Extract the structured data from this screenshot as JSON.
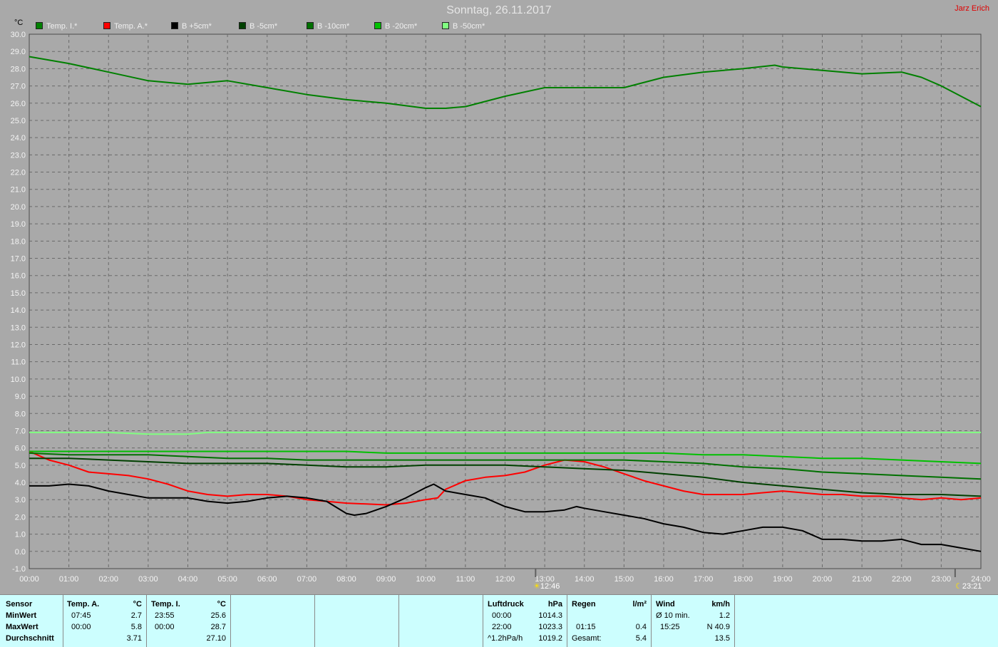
{
  "title": "Sonntag, 26.11.2017",
  "author": "Jarz Erich",
  "y_unit": "°C",
  "markers": [
    {
      "time_label": "12:46",
      "icon": "sunrise-icon",
      "hour": 12.77
    },
    {
      "time_label": "23:21",
      "icon": "moon-icon",
      "hour": 23.35
    }
  ],
  "chart_data": {
    "type": "line",
    "title": "Sonntag, 26.11.2017",
    "ylabel": "°C",
    "ylim": [
      -1.0,
      30.0
    ],
    "xlim": [
      0,
      24
    ],
    "x_tick_labels": [
      "00:00",
      "01:00",
      "02:00",
      "03:00",
      "04:00",
      "05:00",
      "06:00",
      "07:00",
      "08:00",
      "09:00",
      "10:00",
      "11:00",
      "12:00",
      "13:00",
      "14:00",
      "15:00",
      "16:00",
      "17:00",
      "18:00",
      "19:00",
      "20:00",
      "21:00",
      "22:00",
      "23:00",
      "24:00"
    ],
    "y_tick_labels": [
      "-1.0",
      "0.0",
      "1.0",
      "2.0",
      "3.0",
      "4.0",
      "5.0",
      "6.0",
      "7.0",
      "8.0",
      "9.0",
      "10.0",
      "11.0",
      "12.0",
      "13.0",
      "14.0",
      "15.0",
      "16.0",
      "17.0",
      "18.0",
      "19.0",
      "20.0",
      "21.0",
      "22.0",
      "23.0",
      "24.0",
      "25.0",
      "26.0",
      "27.0",
      "28.0",
      "29.0",
      "30.0"
    ],
    "grid": true,
    "legend_position": "top-left",
    "series": [
      {
        "name": "Temp. I.*",
        "color": "#008000",
        "x": [
          0,
          1,
          2,
          3,
          4,
          5,
          6,
          7,
          8,
          9,
          10,
          10.5,
          11,
          12,
          13,
          14,
          15,
          16,
          17,
          18,
          18.8,
          19,
          20,
          21,
          22,
          22.5,
          23,
          23.5,
          24
        ],
        "values": [
          28.7,
          28.3,
          27.8,
          27.3,
          27.1,
          27.3,
          26.9,
          26.5,
          26.2,
          26.0,
          25.7,
          25.7,
          25.8,
          26.4,
          26.9,
          26.9,
          26.9,
          27.5,
          27.8,
          28.0,
          28.2,
          28.1,
          27.9,
          27.7,
          27.8,
          27.5,
          27.0,
          26.4,
          25.8
        ]
      },
      {
        "name": "Temp. A.*",
        "color": "#ff0000",
        "x": [
          0,
          0.5,
          1,
          1.5,
          2,
          2.5,
          3,
          3.5,
          4,
          4.5,
          5,
          5.5,
          6,
          6.5,
          7,
          7.5,
          8,
          8.5,
          9,
          9.5,
          10,
          10.3,
          10.5,
          11,
          11.5,
          12,
          12.5,
          13,
          13.5,
          14,
          14.5,
          15,
          15.5,
          16,
          16.5,
          17,
          17.5,
          18,
          18.5,
          19,
          19.5,
          20,
          20.5,
          21,
          21.5,
          22,
          22.5,
          23,
          23.5,
          24
        ],
        "values": [
          5.8,
          5.3,
          5.0,
          4.6,
          4.5,
          4.4,
          4.2,
          3.9,
          3.5,
          3.3,
          3.2,
          3.3,
          3.3,
          3.2,
          3.0,
          2.9,
          2.8,
          2.75,
          2.7,
          2.8,
          3.0,
          3.1,
          3.6,
          4.1,
          4.3,
          4.4,
          4.6,
          5.0,
          5.3,
          5.2,
          4.9,
          4.5,
          4.1,
          3.8,
          3.5,
          3.3,
          3.3,
          3.3,
          3.4,
          3.5,
          3.4,
          3.3,
          3.3,
          3.2,
          3.2,
          3.1,
          3.0,
          3.1,
          3.0,
          3.1
        ]
      },
      {
        "name": "B +5cm*",
        "color": "#000000",
        "x": [
          0,
          0.5,
          1,
          1.5,
          2,
          2.5,
          3,
          3.5,
          4,
          4.5,
          5,
          5.5,
          6,
          6.5,
          7,
          7.5,
          8,
          8.2,
          8.5,
          9,
          9.5,
          10,
          10.2,
          10.5,
          11,
          11.5,
          12,
          12.5,
          13,
          13.5,
          13.8,
          14,
          14.5,
          15,
          15.5,
          16,
          16.5,
          17,
          17.5,
          18,
          18.5,
          19,
          19.5,
          20,
          20.5,
          21,
          21.5,
          22,
          22.5,
          23,
          23.5,
          24
        ],
        "values": [
          3.8,
          3.8,
          3.9,
          3.8,
          3.5,
          3.3,
          3.1,
          3.1,
          3.1,
          2.9,
          2.8,
          2.9,
          3.1,
          3.2,
          3.1,
          2.9,
          2.2,
          2.1,
          2.2,
          2.6,
          3.1,
          3.7,
          3.9,
          3.5,
          3.3,
          3.1,
          2.6,
          2.3,
          2.3,
          2.4,
          2.6,
          2.5,
          2.3,
          2.1,
          1.9,
          1.6,
          1.4,
          1.1,
          1.0,
          1.2,
          1.4,
          1.4,
          1.2,
          0.7,
          0.7,
          0.6,
          0.6,
          0.7,
          0.4,
          0.4,
          0.2,
          0.0
        ]
      },
      {
        "name": "B -5cm*",
        "color": "#004000",
        "x": [
          0,
          1,
          2,
          3,
          4,
          5,
          6,
          7,
          8,
          9,
          10,
          11,
          12,
          13,
          14,
          15,
          16,
          17,
          18,
          19,
          20,
          21,
          22,
          23,
          24
        ],
        "values": [
          5.4,
          5.4,
          5.3,
          5.2,
          5.1,
          5.1,
          5.1,
          5.0,
          4.9,
          4.9,
          5.0,
          5.0,
          5.0,
          4.9,
          4.8,
          4.7,
          4.5,
          4.3,
          4.0,
          3.8,
          3.6,
          3.4,
          3.3,
          3.3,
          3.2
        ]
      },
      {
        "name": "B -10cm*",
        "color": "#007000",
        "x": [
          0,
          1,
          2,
          3,
          4,
          5,
          6,
          7,
          8,
          9,
          10,
          11,
          12,
          13,
          14,
          15,
          16,
          17,
          18,
          19,
          20,
          21,
          22,
          23,
          24
        ],
        "values": [
          5.7,
          5.6,
          5.6,
          5.6,
          5.5,
          5.4,
          5.4,
          5.3,
          5.3,
          5.3,
          5.3,
          5.3,
          5.3,
          5.3,
          5.3,
          5.3,
          5.2,
          5.1,
          4.9,
          4.8,
          4.6,
          4.5,
          4.4,
          4.3,
          4.2
        ]
      },
      {
        "name": "B -20cm*",
        "color": "#00c000",
        "x": [
          0,
          1,
          2,
          3,
          4,
          5,
          6,
          7,
          8,
          9,
          10,
          11,
          12,
          13,
          14,
          15,
          16,
          17,
          18,
          19,
          20,
          21,
          22,
          23,
          24
        ],
        "values": [
          5.8,
          5.8,
          5.8,
          5.8,
          5.8,
          5.8,
          5.8,
          5.8,
          5.8,
          5.7,
          5.7,
          5.7,
          5.7,
          5.7,
          5.7,
          5.7,
          5.7,
          5.6,
          5.6,
          5.5,
          5.4,
          5.4,
          5.3,
          5.2,
          5.1
        ]
      },
      {
        "name": "B -50cm*",
        "color": "#80ff80",
        "x": [
          0,
          2,
          3,
          4,
          4.5,
          5,
          8,
          12,
          16,
          20,
          24
        ],
        "values": [
          6.9,
          6.9,
          6.8,
          6.8,
          6.9,
          6.9,
          6.9,
          6.9,
          6.9,
          6.9,
          6.9
        ]
      }
    ]
  },
  "stats": {
    "sensor": {
      "header": "Sensor",
      "rows": [
        "MinWert",
        "MaxWert",
        "Durchschnitt"
      ]
    },
    "temp_a": {
      "header": "Temp. A.",
      "unit": "°C",
      "min_time": "07:45",
      "min": "2.7",
      "max_time": "00:00",
      "max": "5.8",
      "avg": "3.71"
    },
    "temp_i": {
      "header": "Temp. I.",
      "unit": "°C",
      "min_time": "23:55",
      "min": "25.6",
      "max_time": "00:00",
      "max": "28.7",
      "avg": "27.10"
    },
    "pressure": {
      "header": "Luftdruck",
      "unit": "hPa",
      "row1_time": "00:00",
      "row1_val": "1014.3",
      "row2_time": "22:00",
      "row2_val": "1023.3",
      "row3_label": "^1.2hPa/h",
      "row3_val": "1019.2"
    },
    "rain": {
      "header": "Regen",
      "unit": "l/m²",
      "row2_time": "01:15",
      "row2_val": "0.4",
      "row3_label": "Gesamt:",
      "row3_val": "5.4"
    },
    "wind": {
      "header": "Wind",
      "unit": "km/h",
      "row1_label": "Ø 10 min.",
      "row1_val": "1.2",
      "row2_time": "15:25",
      "row2_val": "N 40.9",
      "row3_val": "13.5"
    }
  }
}
